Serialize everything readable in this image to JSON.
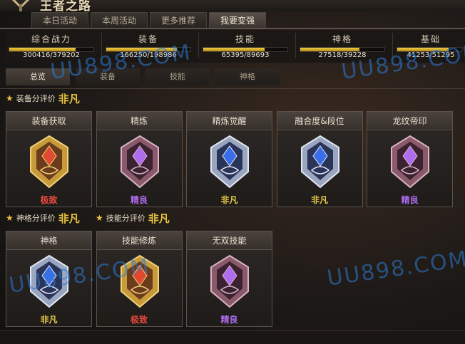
{
  "app_title": "王者之路",
  "main_tabs": [
    {
      "label": "本日活动"
    },
    {
      "label": "本周活动"
    },
    {
      "label": "更多推荐"
    },
    {
      "label": "我要变强"
    }
  ],
  "stats": [
    {
      "label": "综合战力",
      "value": "300416/379202",
      "progress": 0.79
    },
    {
      "label": "装备",
      "value": "166250/198986",
      "progress": 0.84
    },
    {
      "label": "技能",
      "value": "65395/89693",
      "progress": 0.73
    },
    {
      "label": "神格",
      "value": "27518/39228",
      "progress": 0.7
    },
    {
      "label": "基础",
      "value": "41253/51295",
      "progress": 0.8
    }
  ],
  "sub_tabs": [
    {
      "label": "总览"
    },
    {
      "label": "装备"
    },
    {
      "label": "技能"
    },
    {
      "label": "神格"
    }
  ],
  "sections": [
    {
      "label": "装备分评价",
      "grade": "非凡"
    },
    {
      "label": "神格分评价",
      "grade": "非凡"
    },
    {
      "label": "技能分评价",
      "grade": "非凡"
    }
  ],
  "cards_row1": [
    {
      "title": "装备获取",
      "grade": "极致",
      "grade_color": "#e8493e",
      "badge": "gold"
    },
    {
      "title": "精炼",
      "grade": "精良",
      "grade_color": "#b06cf0",
      "badge": "purple"
    },
    {
      "title": "精炼觉醒",
      "grade": "非凡",
      "grade_color": "#e7c84a",
      "badge": "silver"
    },
    {
      "title": "融合度&段位",
      "grade": "非凡",
      "grade_color": "#e7c84a",
      "badge": "silver"
    },
    {
      "title": "龙纹帝印",
      "grade": "精良",
      "grade_color": "#b06cf0",
      "badge": "purple"
    }
  ],
  "cards_row2": [
    {
      "title": "神格",
      "grade": "非凡",
      "grade_color": "#e7c84a",
      "badge": "silver"
    },
    {
      "title": "技能修炼",
      "grade": "极致",
      "grade_color": "#e8493e",
      "badge": "gold"
    },
    {
      "title": "无双技能",
      "grade": "精良",
      "grade_color": "#b06cf0",
      "badge": "purple"
    }
  ],
  "watermark": "UU898.COM"
}
